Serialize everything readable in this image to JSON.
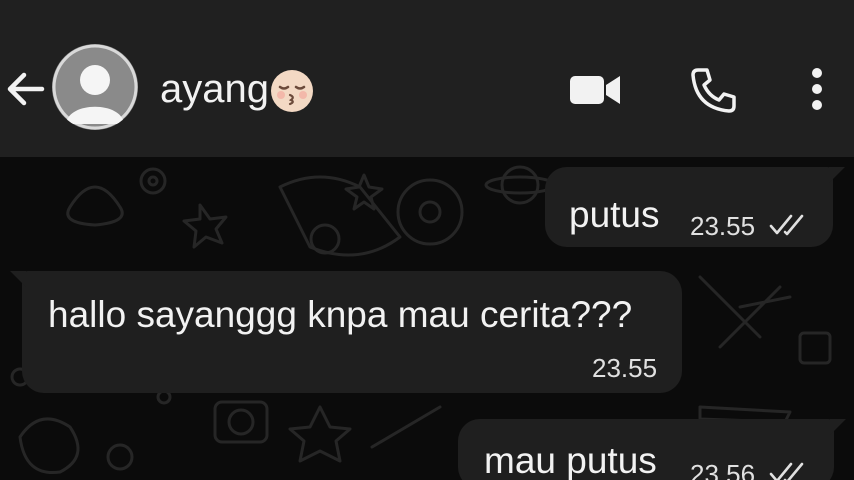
{
  "header": {
    "contact_name": "ayang",
    "contact_emoji": "kissing-face-emoji",
    "icons": [
      "back-arrow-icon",
      "avatar-placeholder-icon",
      "video-call-icon",
      "phone-icon",
      "more-vert-icon"
    ]
  },
  "messages": [
    {
      "direction": "outgoing",
      "text": "putus",
      "time": "23.55",
      "status": "read-double-check"
    },
    {
      "direction": "incoming",
      "text": "hallo sayanggg knpa mau cerita???",
      "time": "23.55"
    },
    {
      "direction": "outgoing",
      "text": "mau putus",
      "time": "23.56",
      "status": "read-double-check"
    }
  ],
  "colors": {
    "header_bg": "#202020",
    "chat_bg": "#0b0b0b",
    "bubble_bg": "#1f1f1f",
    "text": "#f2f2f2",
    "doodle": "#262626"
  }
}
